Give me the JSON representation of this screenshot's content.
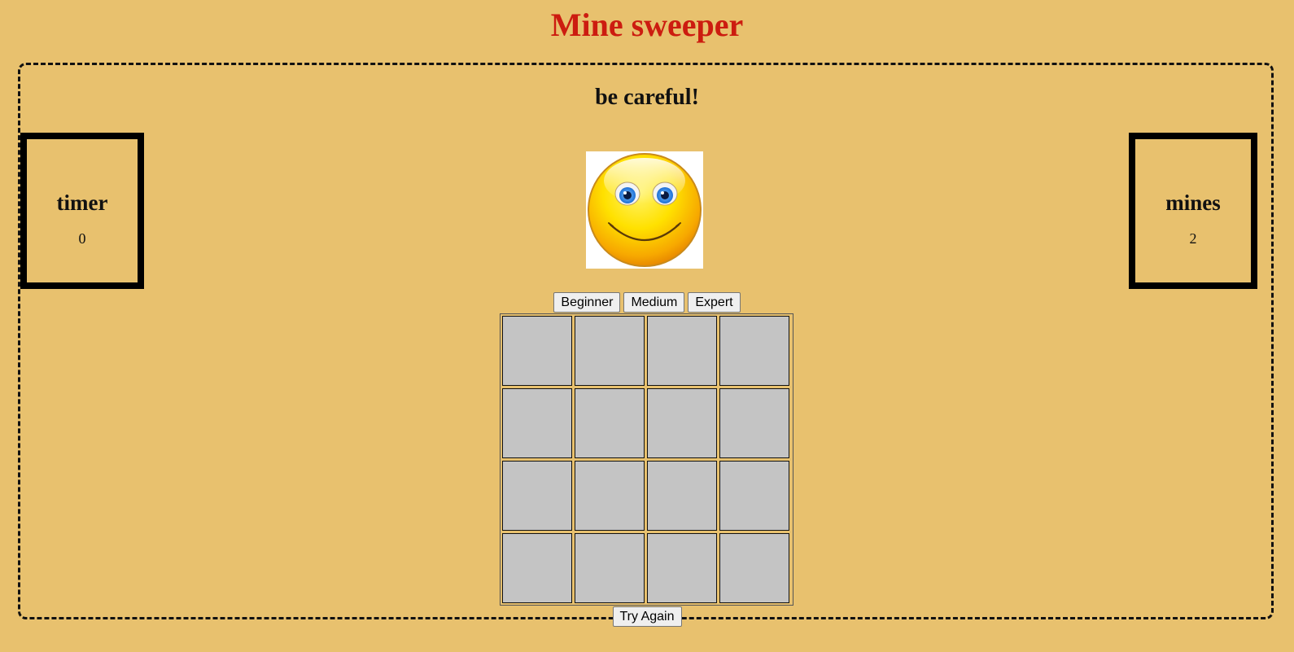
{
  "title": "Mine sweeper",
  "status": "be careful!",
  "timer": {
    "label": "timer",
    "value": "0"
  },
  "mines": {
    "label": "mines",
    "value": "2"
  },
  "levels": [
    "Beginner",
    "Medium",
    "Expert"
  ],
  "board": {
    "rows": 4,
    "cols": 4
  },
  "retry_label": "Try Again",
  "colors": {
    "background": "#e8c16e",
    "title": "#cc1c10",
    "cell": "#c4c4c4"
  },
  "smiley": "smiley-face-icon"
}
